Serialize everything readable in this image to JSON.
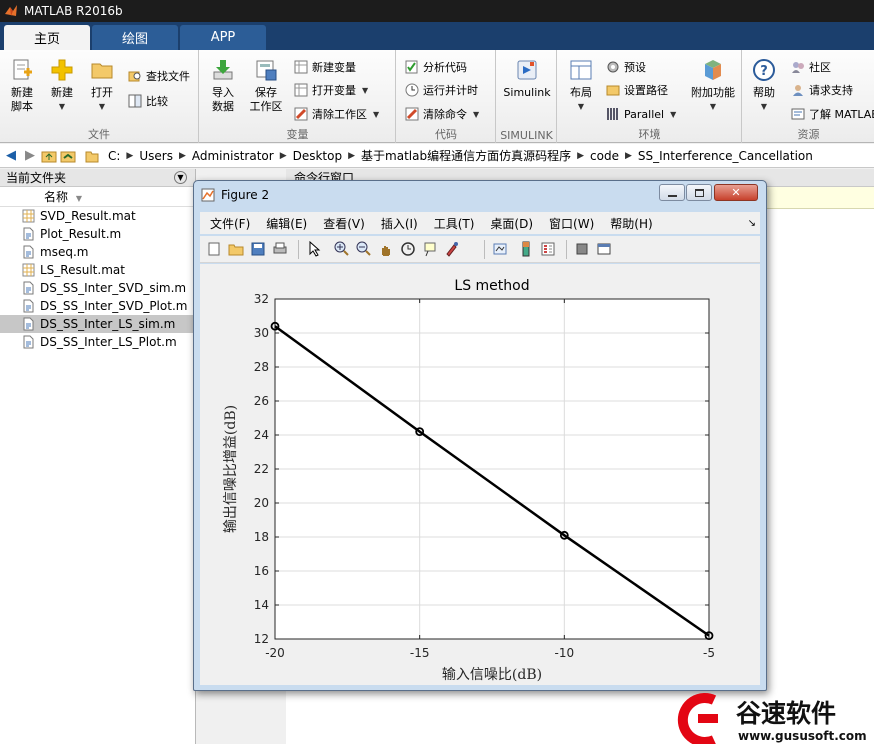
{
  "window": {
    "title": "MATLAB R2016b"
  },
  "ribbon_tabs": [
    "主页",
    "绘图",
    "APP"
  ],
  "ribbon": {
    "file": {
      "new_script": [
        "新建",
        "脚本"
      ],
      "new": "新建",
      "open": "打开",
      "find_files": "查找文件",
      "compare": "比较",
      "group": "文件"
    },
    "variable": {
      "import": [
        "导入",
        "数据"
      ],
      "save": [
        "保存",
        "工作区"
      ],
      "new_var": "新建变量",
      "open_var": "打开变量",
      "clear_ws": "清除工作区",
      "group": "变量"
    },
    "code": {
      "analyze": "分析代码",
      "run_time": "运行并计时",
      "clear_cmd": "清除命令",
      "group": "代码"
    },
    "simulink": {
      "btn": "Simulink",
      "group": "SIMULINK"
    },
    "env": {
      "layout": "布局",
      "prefs": "预设",
      "set_path": "设置路径",
      "parallel": "Parallel",
      "addons": "附加功能",
      "group": "环境"
    },
    "resources": {
      "help": "帮助",
      "community": "社区",
      "support": "请求支持",
      "learn": "了解 MATLAB",
      "group": "资源"
    }
  },
  "address": [
    "C:",
    "Users",
    "Administrator",
    "Desktop",
    "基于matlab编程通信方面仿真源码程序",
    "code",
    "SS_Interference_Cancellation"
  ],
  "left_panel": {
    "title": "当前文件夹",
    "col_name": "名称",
    "files": [
      {
        "name": "SVD_Result.mat",
        "type": "mat",
        "selected": false
      },
      {
        "name": "Plot_Result.m",
        "type": "m",
        "selected": false
      },
      {
        "name": "mseq.m",
        "type": "m",
        "selected": false
      },
      {
        "name": "LS_Result.mat",
        "type": "mat",
        "selected": false
      },
      {
        "name": "DS_SS_Inter_SVD_sim.m",
        "type": "m",
        "selected": false
      },
      {
        "name": "DS_SS_Inter_SVD_Plot.m",
        "type": "m",
        "selected": false
      },
      {
        "name": "DS_SS_Inter_LS_sim.m",
        "type": "m",
        "selected": true
      },
      {
        "name": "DS_SS_Inter_LS_Plot.m",
        "type": "m",
        "selected": false
      }
    ]
  },
  "cmd_window": {
    "title": "命令行窗口"
  },
  "figure": {
    "title": "Figure 2",
    "menu": [
      "文件(F)",
      "编辑(E)",
      "查看(V)",
      "插入(I)",
      "工具(T)",
      "桌面(D)",
      "窗口(W)",
      "帮助(H)"
    ],
    "toolbar_icons": [
      "new-figure-icon",
      "open-file-icon",
      "save-icon",
      "print-icon",
      "pointer-icon",
      "zoom-in-icon",
      "zoom-out-icon",
      "pan-icon",
      "rotate-icon",
      "data-cursor-icon",
      "brush-icon",
      "link-plot-icon",
      "colorbar-icon",
      "legend-icon",
      "hide-tools-icon",
      "show-tools-icon"
    ]
  },
  "chart_data": {
    "type": "line",
    "title": "LS method",
    "xlabel": "输入信噪比(dB)",
    "ylabel": "输出信噪比增益(dB)",
    "x": [
      -20,
      -15,
      -10,
      -5
    ],
    "series": [
      {
        "values": [
          30.4,
          24.2,
          18.1,
          12.2
        ],
        "color": "#000000",
        "marker": "circle"
      }
    ],
    "xlim": [
      -20,
      -5
    ],
    "ylim": [
      12,
      32
    ],
    "xticks": [
      -20,
      -15,
      -10,
      -5
    ],
    "yticks": [
      12,
      14,
      16,
      18,
      20,
      22,
      24,
      26,
      28,
      30,
      32
    ],
    "grid": true
  },
  "watermark": {
    "text": "谷速软件",
    "url": "www.gususoft.com",
    "color": "#e30613"
  }
}
